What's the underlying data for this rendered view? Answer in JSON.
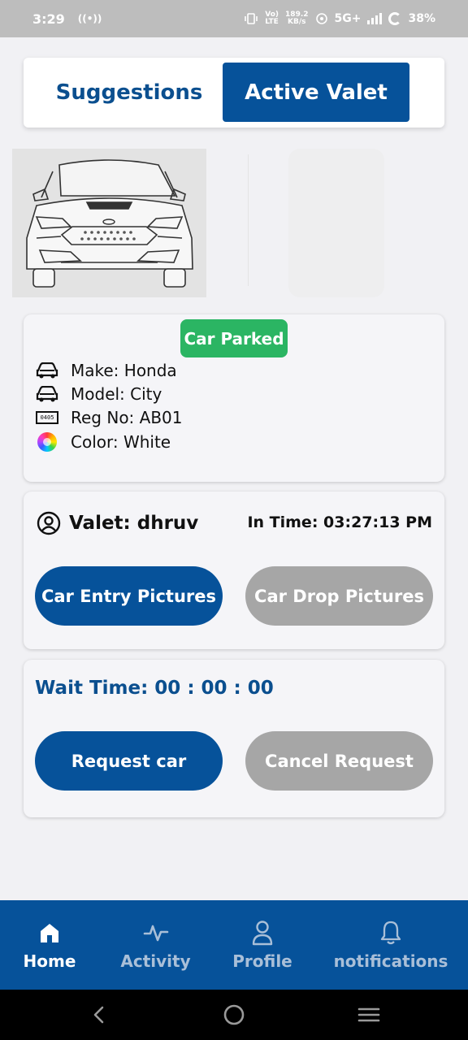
{
  "status_bar": {
    "time": "3:29",
    "network_speed_value": "189.2",
    "network_speed_unit": "KB/s",
    "network_type": "5G+",
    "battery": "38%"
  },
  "tabs": {
    "suggestions": "Suggestions",
    "active_valet": "Active Valet",
    "selected": "active_valet"
  },
  "car_info": {
    "status": "Car Parked",
    "make": "Make: Honda",
    "model": "Model: City",
    "plate_icon_text": "0405",
    "reg_no": "Reg No: AB01",
    "color": "Color: White"
  },
  "valet": {
    "name": "Valet: dhruv",
    "in_time": "In Time: 03:27:13 PM",
    "entry_pictures_button": "Car Entry Pictures",
    "drop_pictures_button": "Car Drop Pictures"
  },
  "wait": {
    "wait_time": "Wait Time: 00 : 00 : 00",
    "request_button": "Request car",
    "cancel_button": "Cancel Request"
  },
  "bottom_nav": {
    "home": "Home",
    "activity": "Activity",
    "profile": "Profile",
    "notifications": "notifications",
    "active": "home"
  },
  "colors": {
    "primary": "#06529a",
    "status_green": "#2bb563",
    "disabled_grey": "#a6a6a6",
    "background": "#f1f1f4"
  },
  "icons": {
    "make": "car-icon",
    "model": "car-icon",
    "reg": "license-plate-icon",
    "color": "color-wheel-icon",
    "valet": "user-circle-icon",
    "home": "home-icon",
    "activity": "activity-icon",
    "profile": "profile-icon",
    "notifications": "bell-icon"
  }
}
